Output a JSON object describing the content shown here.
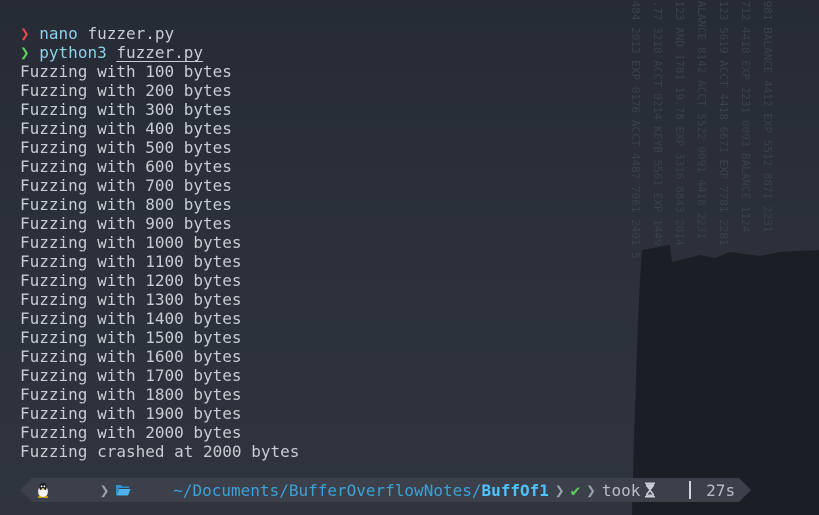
{
  "history": [
    {
      "symbol": "❯",
      "symbol_color": "#e5484d",
      "command": "nano",
      "argument": "fuzzer.py",
      "underline_arg": false
    },
    {
      "symbol": "❯",
      "symbol_color": "#5fd05f",
      "command": "python3",
      "argument": "fuzzer.py",
      "underline_arg": true
    }
  ],
  "output": [
    "Fuzzing with 100 bytes",
    "Fuzzing with 200 bytes",
    "Fuzzing with 300 bytes",
    "Fuzzing with 400 bytes",
    "Fuzzing with 500 bytes",
    "Fuzzing with 600 bytes",
    "Fuzzing with 700 bytes",
    "Fuzzing with 800 bytes",
    "Fuzzing with 900 bytes",
    "Fuzzing with 1000 bytes",
    "Fuzzing with 1100 bytes",
    "Fuzzing with 1200 bytes",
    "Fuzzing with 1300 bytes",
    "Fuzzing with 1400 bytes",
    "Fuzzing with 1500 bytes",
    "Fuzzing with 1600 bytes",
    "Fuzzing with 1700 bytes",
    "Fuzzing with 1800 bytes",
    "Fuzzing with 1900 bytes",
    "Fuzzing with 2000 bytes",
    "Fuzzing crashed at 2000 bytes"
  ],
  "prompt": {
    "os_icon": "linux-tux-icon",
    "folder_icon": "folder-open-icon",
    "path_prefix": "~/Documents/BufferOverflowNotes/",
    "path_current": "BuffOf1",
    "status_icon": "✔",
    "took_label": "took",
    "timer_icon": "hourglass-icon",
    "duration": "27s"
  },
  "wallpaper": {
    "columns": [
      "4484 2013 EXP 0176 ACCT 4487 7961 2491 5",
      "2.77 3218 ACCT 0214 KEYB 5561 EXP 1449",
      "4123 AND 1781 19.78 EXP 3316 8843 2014",
      "BALANCE 8142 ACCT 5522 0091 4418 2231",
      "0123 5619 ACCT 4418 6671 EXP 7781 2281",
      "7712 4418 EXP 2231 0093 BALANCE 1124",
      "9981 BALANCE 4412 EXP 5512 8871 2231"
    ],
    "accent_color": "#1a1d23"
  }
}
